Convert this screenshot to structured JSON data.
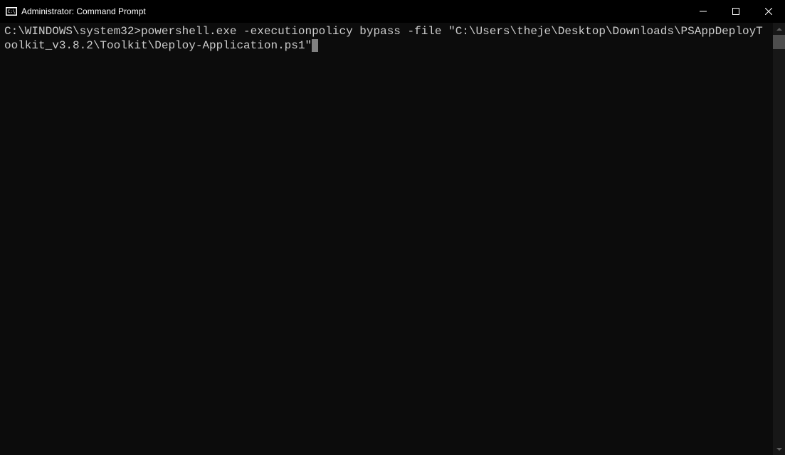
{
  "window": {
    "title": "Administrator: Command Prompt"
  },
  "terminal": {
    "prompt": "C:\\WINDOWS\\system32>",
    "command": "powershell.exe -executionpolicy bypass -file \"C:\\Users\\theje\\Desktop\\Downloads\\PSAppDeployToolkit_v3.8.2\\Toolkit\\Deploy-Application.ps1\""
  }
}
